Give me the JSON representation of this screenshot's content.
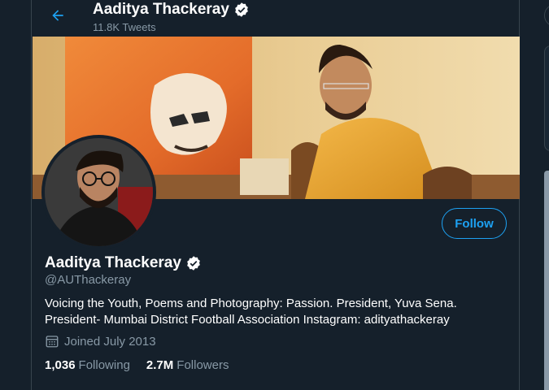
{
  "header": {
    "name": "Aaditya Thackeray",
    "tweet_count": "11.8K Tweets"
  },
  "profile": {
    "name": "Aaditya Thackeray",
    "handle": "@AUThackeray",
    "bio": "Voicing the Youth, Poems and Photography: Passion. President, Yuva Sena. President- Mumbai District Football Association Instagram: adityathackeray",
    "joined": "Joined July 2013",
    "verified": true
  },
  "stats": {
    "following_count": "1,036",
    "following_label": "Following",
    "followers_count": "2.7M",
    "followers_label": "Followers"
  },
  "actions": {
    "follow_label": "Follow"
  },
  "colors": {
    "background": "#15202b",
    "accent": "#1da1f2",
    "muted": "#8899a6",
    "border": "#38444d"
  },
  "icons": {
    "back": "arrow-left-icon",
    "verified": "verified-badge-icon",
    "calendar": "calendar-icon"
  }
}
